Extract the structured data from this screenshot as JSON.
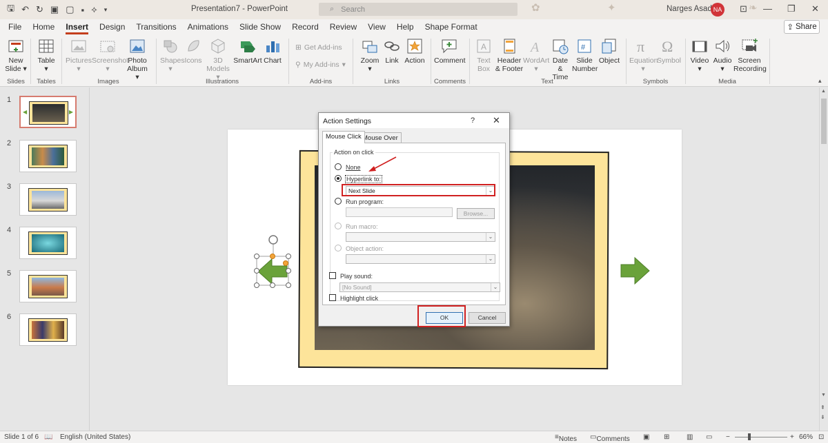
{
  "app": {
    "title": "Presentation7  -  PowerPoint",
    "search_placeholder": "Search",
    "user_name": "Narges Asadi",
    "user_initials": "NA",
    "share": "Share"
  },
  "tabs": [
    "File",
    "Home",
    "Insert",
    "Design",
    "Transitions",
    "Animations",
    "Slide Show",
    "Record",
    "Review",
    "View",
    "Help",
    "Shape Format"
  ],
  "ribbon": {
    "new_slide": [
      "New",
      "Slide"
    ],
    "table": "Table",
    "pictures": "Pictures",
    "screenshot": "Screenshot",
    "photo_album": [
      "Photo",
      "Album"
    ],
    "shapes": "Shapes",
    "icons": "Icons",
    "models_3d": [
      "3D",
      "Models"
    ],
    "smartart": "SmartArt",
    "chart": "Chart",
    "get_addins": "Get Add-ins",
    "my_addins": "My Add-ins",
    "zoom": "Zoom",
    "link": "Link",
    "action": "Action",
    "comment": "Comment",
    "text_box": [
      "Text",
      "Box"
    ],
    "header_footer": [
      "Header",
      "& Footer"
    ],
    "wordart": "WordArt",
    "date_time": [
      "Date &",
      "Time"
    ],
    "slide_number": [
      "Slide",
      "Number"
    ],
    "object": "Object",
    "equation": "Equation",
    "symbol": "Symbol",
    "video": "Video",
    "audio": "Audio",
    "screen_recording": [
      "Screen",
      "Recording"
    ],
    "groups": {
      "slides": "Slides",
      "tables": "Tables",
      "images": "Images",
      "illustrations": "Illustrations",
      "addins": "Add-ins",
      "links": "Links",
      "comments": "Comments",
      "text": "Text",
      "symbols": "Symbols",
      "media": "Media"
    }
  },
  "thumbnails": [
    "1",
    "2",
    "3",
    "4",
    "5",
    "6"
  ],
  "dialog": {
    "title": "Action Settings",
    "help": "?",
    "close": "✕",
    "tab_click": "Mouse Click",
    "tab_over": "Mouse Over",
    "group": "Action on click",
    "none": "None",
    "hyperlink": "Hyperlink to:",
    "hyperlink_value": "Next Slide",
    "run_program": "Run program:",
    "browse": "Browse...",
    "run_macro": "Run macro:",
    "object_action": "Object action:",
    "play_sound": "Play sound:",
    "sound_value": "[No Sound]",
    "highlight": "Highlight click",
    "ok": "OK",
    "cancel": "Cancel"
  },
  "status": {
    "slide": "Slide 1 of 6",
    "language": "English (United States)",
    "notes": "Notes",
    "comments": "Comments",
    "zoom": "66%"
  },
  "colors": {
    "accent": "#c43e1c",
    "arrow_green": "#6aa23a",
    "frame_yellow": "#fde49a",
    "highlight_red": "#d02020"
  }
}
